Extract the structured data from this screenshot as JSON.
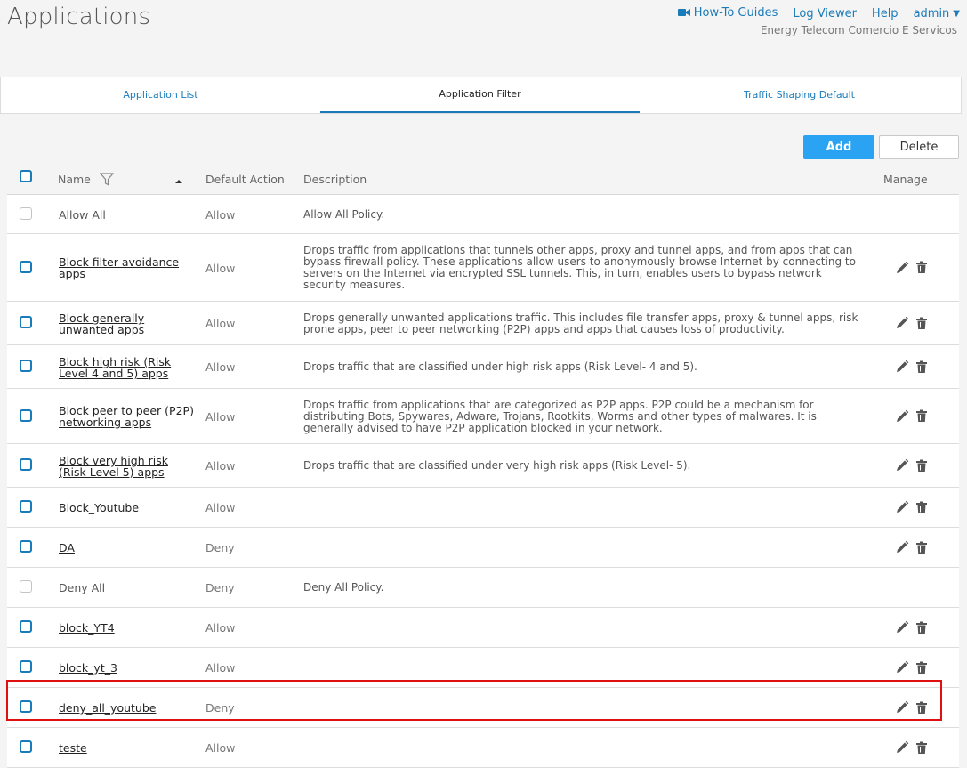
{
  "header": {
    "title": "Applications",
    "links": [
      {
        "label": "How-To Guides",
        "icon": "video-camera-icon"
      },
      {
        "label": "Log Viewer"
      },
      {
        "label": "Help"
      },
      {
        "label": "admin",
        "icon": "caret-down-icon"
      }
    ],
    "organization": "Energy Telecom Comercio E Servicos"
  },
  "tabs": [
    {
      "label": "Application List",
      "active": false
    },
    {
      "label": "Application Filter",
      "active": true
    },
    {
      "label": "Traffic Shaping Default",
      "active": false
    }
  ],
  "toolbar": {
    "add_label": "Add",
    "delete_label": "Delete"
  },
  "table": {
    "columns": {
      "name": "Name",
      "default_action": "Default Action",
      "description": "Description",
      "manage": "Manage"
    },
    "rows": [
      {
        "name": "Allow All",
        "action": "Allow",
        "description": "Allow All Policy.",
        "editable": false
      },
      {
        "name": "Block filter avoidance apps",
        "action": "Allow",
        "description": "Drops traffic from applications that tunnels other apps, proxy and tunnel apps, and from apps that can bypass firewall policy. These applications allow users to anonymously browse Internet by connecting to servers on the Internet via encrypted SSL tunnels. This, in turn, enables users to bypass network security measures.",
        "editable": true
      },
      {
        "name": "Block generally unwanted apps",
        "action": "Allow",
        "description": "Drops generally unwanted applications traffic. This includes file transfer apps, proxy & tunnel apps, risk prone apps, peer to peer networking (P2P) apps and apps that causes loss of productivity.",
        "editable": true
      },
      {
        "name": "Block high risk (Risk Level 4 and 5) apps",
        "action": "Allow",
        "description": "Drops traffic that are classified under high risk apps (Risk Level- 4 and 5).",
        "editable": true
      },
      {
        "name": "Block peer to peer (P2P) networking apps",
        "action": "Allow",
        "description": "Drops traffic from applications that are categorized as P2P apps. P2P could be a mechanism for distributing Bots, Spywares, Adware, Trojans, Rootkits, Worms and other types of malwares. It is generally advised to have P2P application blocked in your network.",
        "editable": true
      },
      {
        "name": "Block very high risk (Risk Level 5) apps",
        "action": "Allow",
        "description": "Drops traffic that are classified under very high risk apps (Risk Level- 5).",
        "editable": true
      },
      {
        "name": "Block_Youtube",
        "action": "Allow",
        "description": "",
        "editable": true
      },
      {
        "name": "DA",
        "action": "Deny",
        "description": "",
        "editable": true
      },
      {
        "name": "Deny All",
        "action": "Deny",
        "description": "Deny All Policy.",
        "editable": false
      },
      {
        "name": "block_YT4",
        "action": "Allow",
        "description": "",
        "editable": true
      },
      {
        "name": "block_yt_3",
        "action": "Allow",
        "description": "",
        "editable": true
      },
      {
        "name": "deny_all_youtube",
        "action": "Deny",
        "description": "",
        "editable": true
      },
      {
        "name": "teste",
        "action": "Allow",
        "description": "",
        "editable": true
      }
    ]
  },
  "colors": {
    "accent": "#1a7bb9",
    "add_button": "#29a3f2",
    "highlight": "#e01010"
  }
}
